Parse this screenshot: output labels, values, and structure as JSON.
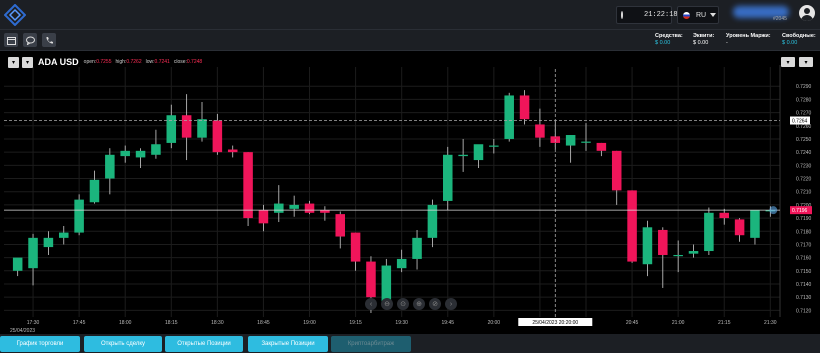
{
  "topbar": {
    "time": "21:22:18",
    "language": "RU",
    "user_sub": "#2045"
  },
  "infobar": {
    "tools": [
      {
        "icon": "calendar-icon"
      },
      {
        "icon": "chat-icon"
      },
      {
        "icon": "phone-icon"
      }
    ],
    "account": [
      {
        "label": "Средства:",
        "value": "$ 0.00"
      },
      {
        "label": "Эквити:",
        "value": "$ 0.00"
      },
      {
        "label": "Уровень Маржи:",
        "value": "-"
      },
      {
        "label": "Свободные:",
        "value": "$ 0.00"
      }
    ]
  },
  "chart_header": {
    "symbol": "ADA USD",
    "open_label": "open:",
    "open": "0.7255",
    "high_label": "high:",
    "high": "0.7262",
    "low_label": "low:",
    "low": "0.7241",
    "close_label": "close:",
    "close": "0.7248"
  },
  "colors": {
    "up": "#1bb57d",
    "down": "#f0155a",
    "accent": "#2ebce0",
    "background": "#000000"
  },
  "chart_data": {
    "type": "candlestick",
    "symbol": "ADA USD",
    "y_ticks": [
      "0.7290",
      "0.7280",
      "0.7270",
      "0.7260",
      "0.7250",
      "0.7240",
      "0.7230",
      "0.7220",
      "0.7210",
      "0.7200",
      "0.7190",
      "0.7180",
      "0.7170",
      "0.7160",
      "0.7150",
      "0.7140",
      "0.7130",
      "0.7120"
    ],
    "ylim": [
      0.7118,
      0.7297
    ],
    "x_ticks": [
      "17:30",
      "17:45",
      "18:00",
      "18:15",
      "18:30",
      "18:45",
      "19:00",
      "19:15",
      "19:30",
      "19:45",
      "20:00",
      "20:15",
      "20:30",
      "20:45",
      "21:00",
      "21:15",
      "21:30"
    ],
    "first_date": "25/04/2023",
    "crosshair_label": "25/04/2023 20:20:00",
    "current_price_label": "0.7196",
    "crosshair_price_label": "0.7264",
    "grid": true,
    "candles": [
      {
        "t": "17:25",
        "o": 0.715,
        "h": 0.7158,
        "l": 0.7146,
        "c": 0.716
      },
      {
        "t": "17:30",
        "o": 0.7152,
        "h": 0.7178,
        "l": 0.7139,
        "c": 0.7175
      },
      {
        "t": "17:35",
        "o": 0.7168,
        "h": 0.718,
        "l": 0.7162,
        "c": 0.7175
      },
      {
        "t": "17:40",
        "o": 0.7175,
        "h": 0.7184,
        "l": 0.717,
        "c": 0.7179
      },
      {
        "t": "17:45",
        "o": 0.7179,
        "h": 0.7208,
        "l": 0.7177,
        "c": 0.7204
      },
      {
        "t": "17:50",
        "o": 0.7202,
        "h": 0.7226,
        "l": 0.7201,
        "c": 0.7219
      },
      {
        "t": "17:55",
        "o": 0.722,
        "h": 0.7243,
        "l": 0.7208,
        "c": 0.7238
      },
      {
        "t": "18:00",
        "o": 0.7237,
        "h": 0.7245,
        "l": 0.7232,
        "c": 0.7241
      },
      {
        "t": "18:05",
        "o": 0.7236,
        "h": 0.7243,
        "l": 0.7228,
        "c": 0.7241
      },
      {
        "t": "18:10",
        "o": 0.7238,
        "h": 0.7257,
        "l": 0.7235,
        "c": 0.7246
      },
      {
        "t": "18:15",
        "o": 0.7247,
        "h": 0.7276,
        "l": 0.7243,
        "c": 0.7268
      },
      {
        "t": "18:20",
        "o": 0.7268,
        "h": 0.7284,
        "l": 0.7234,
        "c": 0.7251
      },
      {
        "t": "18:25",
        "o": 0.7251,
        "h": 0.7278,
        "l": 0.7248,
        "c": 0.7265
      },
      {
        "t": "18:30",
        "o": 0.7264,
        "h": 0.7269,
        "l": 0.7238,
        "c": 0.724
      },
      {
        "t": "18:35",
        "o": 0.7242,
        "h": 0.7245,
        "l": 0.7236,
        "c": 0.724
      },
      {
        "t": "18:40",
        "o": 0.724,
        "h": 0.724,
        "l": 0.7184,
        "c": 0.719
      },
      {
        "t": "18:45",
        "o": 0.7196,
        "h": 0.72,
        "l": 0.718,
        "c": 0.7186
      },
      {
        "t": "18:50",
        "o": 0.7194,
        "h": 0.7215,
        "l": 0.7187,
        "c": 0.7201
      },
      {
        "t": "18:55",
        "o": 0.7197,
        "h": 0.7207,
        "l": 0.7191,
        "c": 0.72
      },
      {
        "t": "19:00",
        "o": 0.7201,
        "h": 0.7203,
        "l": 0.7193,
        "c": 0.7194
      },
      {
        "t": "19:05",
        "o": 0.7196,
        "h": 0.7199,
        "l": 0.7188,
        "c": 0.7194
      },
      {
        "t": "19:10",
        "o": 0.7193,
        "h": 0.7195,
        "l": 0.7167,
        "c": 0.7176
      },
      {
        "t": "19:15",
        "o": 0.7179,
        "h": 0.7179,
        "l": 0.715,
        "c": 0.7157
      },
      {
        "t": "19:20",
        "o": 0.7157,
        "h": 0.7161,
        "l": 0.7118,
        "c": 0.713
      },
      {
        "t": "19:25",
        "o": 0.7126,
        "h": 0.7159,
        "l": 0.7121,
        "c": 0.7154
      },
      {
        "t": "19:30",
        "o": 0.7152,
        "h": 0.7166,
        "l": 0.7149,
        "c": 0.7159
      },
      {
        "t": "19:35",
        "o": 0.7159,
        "h": 0.7181,
        "l": 0.7151,
        "c": 0.7175
      },
      {
        "t": "19:40",
        "o": 0.7175,
        "h": 0.7204,
        "l": 0.7168,
        "c": 0.72
      },
      {
        "t": "19:45",
        "o": 0.7203,
        "h": 0.7244,
        "l": 0.7196,
        "c": 0.7238
      },
      {
        "t": "19:50",
        "o": 0.7237,
        "h": 0.725,
        "l": 0.7225,
        "c": 0.7238
      },
      {
        "t": "19:55",
        "o": 0.7234,
        "h": 0.7245,
        "l": 0.7228,
        "c": 0.7246
      },
      {
        "t": "20:00",
        "o": 0.7245,
        "h": 0.725,
        "l": 0.7239,
        "c": 0.7245
      },
      {
        "t": "20:05",
        "o": 0.725,
        "h": 0.7285,
        "l": 0.7248,
        "c": 0.7283
      },
      {
        "t": "20:10",
        "o": 0.7283,
        "h": 0.7287,
        "l": 0.7261,
        "c": 0.7265
      },
      {
        "t": "20:15",
        "o": 0.7261,
        "h": 0.7273,
        "l": 0.7244,
        "c": 0.7251
      },
      {
        "t": "20:20",
        "o": 0.7252,
        "h": 0.7264,
        "l": 0.7242,
        "c": 0.7247
      },
      {
        "t": "20:25",
        "o": 0.7245,
        "h": 0.7253,
        "l": 0.7232,
        "c": 0.7253
      },
      {
        "t": "20:30",
        "o": 0.7248,
        "h": 0.7262,
        "l": 0.7241,
        "c": 0.7248
      },
      {
        "t": "20:35",
        "o": 0.7247,
        "h": 0.7247,
        "l": 0.7237,
        "c": 0.7241
      },
      {
        "t": "20:40",
        "o": 0.7241,
        "h": 0.7241,
        "l": 0.72,
        "c": 0.7211
      },
      {
        "t": "20:45",
        "o": 0.7211,
        "h": 0.7211,
        "l": 0.7156,
        "c": 0.7157
      },
      {
        "t": "20:50",
        "o": 0.7155,
        "h": 0.7188,
        "l": 0.7146,
        "c": 0.7183
      },
      {
        "t": "20:55",
        "o": 0.7181,
        "h": 0.7183,
        "l": 0.7137,
        "c": 0.7162
      },
      {
        "t": "21:00",
        "o": 0.7162,
        "h": 0.7173,
        "l": 0.7149,
        "c": 0.7162
      },
      {
        "t": "21:05",
        "o": 0.7163,
        "h": 0.717,
        "l": 0.716,
        "c": 0.7165
      },
      {
        "t": "21:10",
        "o": 0.7165,
        "h": 0.7198,
        "l": 0.7162,
        "c": 0.7194
      },
      {
        "t": "21:15",
        "o": 0.7194,
        "h": 0.7197,
        "l": 0.7185,
        "c": 0.719
      },
      {
        "t": "21:20",
        "o": 0.7189,
        "h": 0.719,
        "l": 0.7172,
        "c": 0.7177
      },
      {
        "t": "21:25",
        "o": 0.7175,
        "h": 0.7196,
        "l": 0.717,
        "c": 0.7196
      },
      {
        "t": "21:30",
        "o": 0.7196,
        "h": 0.7199,
        "l": 0.7191,
        "c": 0.7196
      }
    ]
  },
  "zoom_controls": [
    {
      "icon": "chevron-left-icon",
      "glyph": "‹"
    },
    {
      "icon": "zoom-out-icon",
      "glyph": "⊖"
    },
    {
      "icon": "zoom-reset-icon",
      "glyph": "⊙"
    },
    {
      "icon": "zoom-in-icon",
      "glyph": "⊕"
    },
    {
      "icon": "zoom-fit-icon",
      "glyph": "⊘"
    },
    {
      "icon": "chevron-right-icon",
      "glyph": "›"
    }
  ],
  "bottom_tabs": [
    {
      "label": "График торговли",
      "enabled": true
    },
    {
      "label": "Открыть сделку",
      "enabled": true
    },
    {
      "label": "Открытые Позиции",
      "enabled": true
    },
    {
      "label": "Закрытые Позиции",
      "enabled": true
    },
    {
      "label": "Криптоарбитраж",
      "enabled": false
    }
  ]
}
